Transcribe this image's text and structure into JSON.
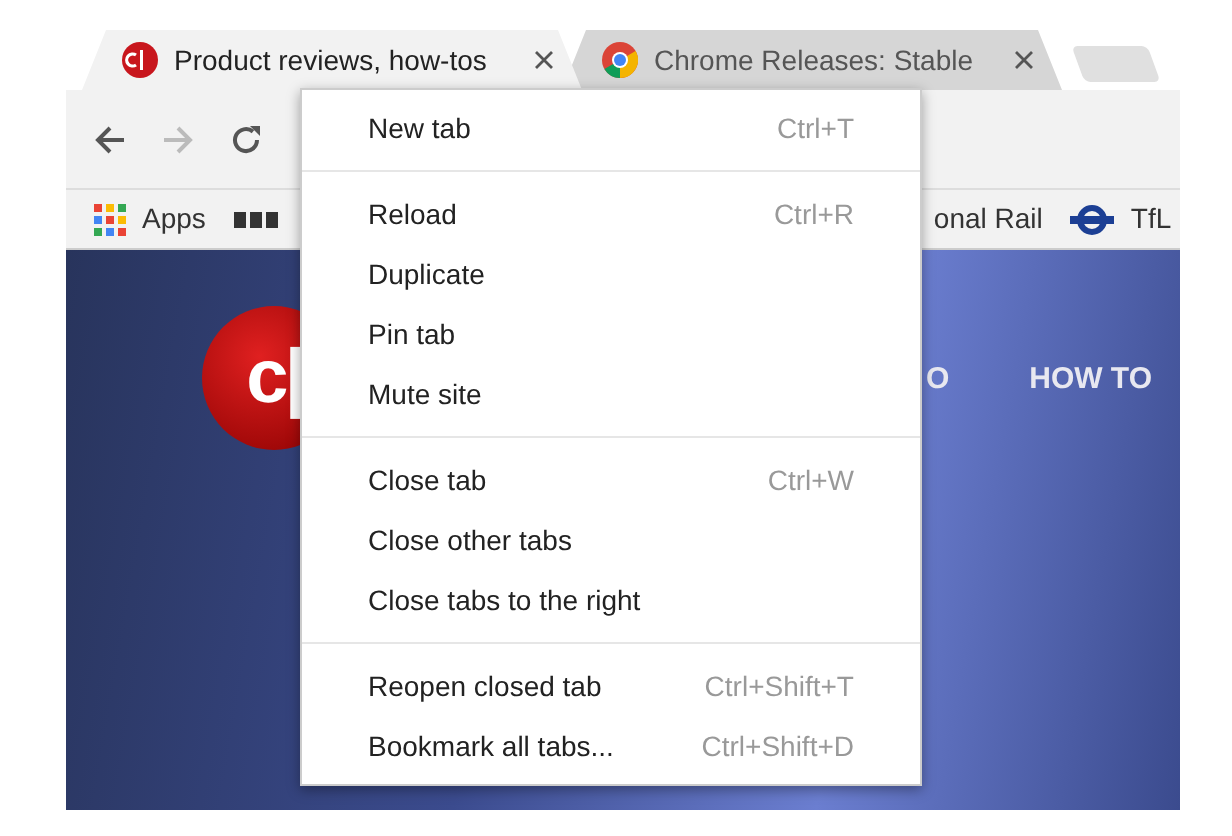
{
  "tabs": [
    {
      "title": "Product reviews, how-tos",
      "kind": "site",
      "selected": true
    },
    {
      "title": "Chrome Releases: Stable",
      "kind": "chrome",
      "selected": false
    }
  ],
  "toolbar": {
    "back_disabled": false,
    "forward_disabled": true
  },
  "bookmarks": [
    {
      "label": "Apps",
      "kind": "apps"
    },
    {
      "kind": "bbc"
    },
    {
      "label": "onal Rail",
      "kind": "text"
    },
    {
      "label": "TfL",
      "kind": "tfl"
    }
  ],
  "site": {
    "logo_text": "c|",
    "nav": [
      "O",
      "HOW TO"
    ]
  },
  "menu": {
    "sections": [
      [
        {
          "label": "New tab",
          "shortcut": "Ctrl+T"
        }
      ],
      [
        {
          "label": "Reload",
          "shortcut": "Ctrl+R"
        },
        {
          "label": "Duplicate"
        },
        {
          "label": "Pin tab"
        },
        {
          "label": "Mute site"
        }
      ],
      [
        {
          "label": "Close tab",
          "shortcut": "Ctrl+W"
        },
        {
          "label": "Close other tabs"
        },
        {
          "label": "Close tabs to the right"
        }
      ],
      [
        {
          "label": "Reopen closed tab",
          "shortcut": "Ctrl+Shift+T"
        },
        {
          "label": "Bookmark all tabs...",
          "shortcut": "Ctrl+Shift+D"
        }
      ]
    ]
  }
}
